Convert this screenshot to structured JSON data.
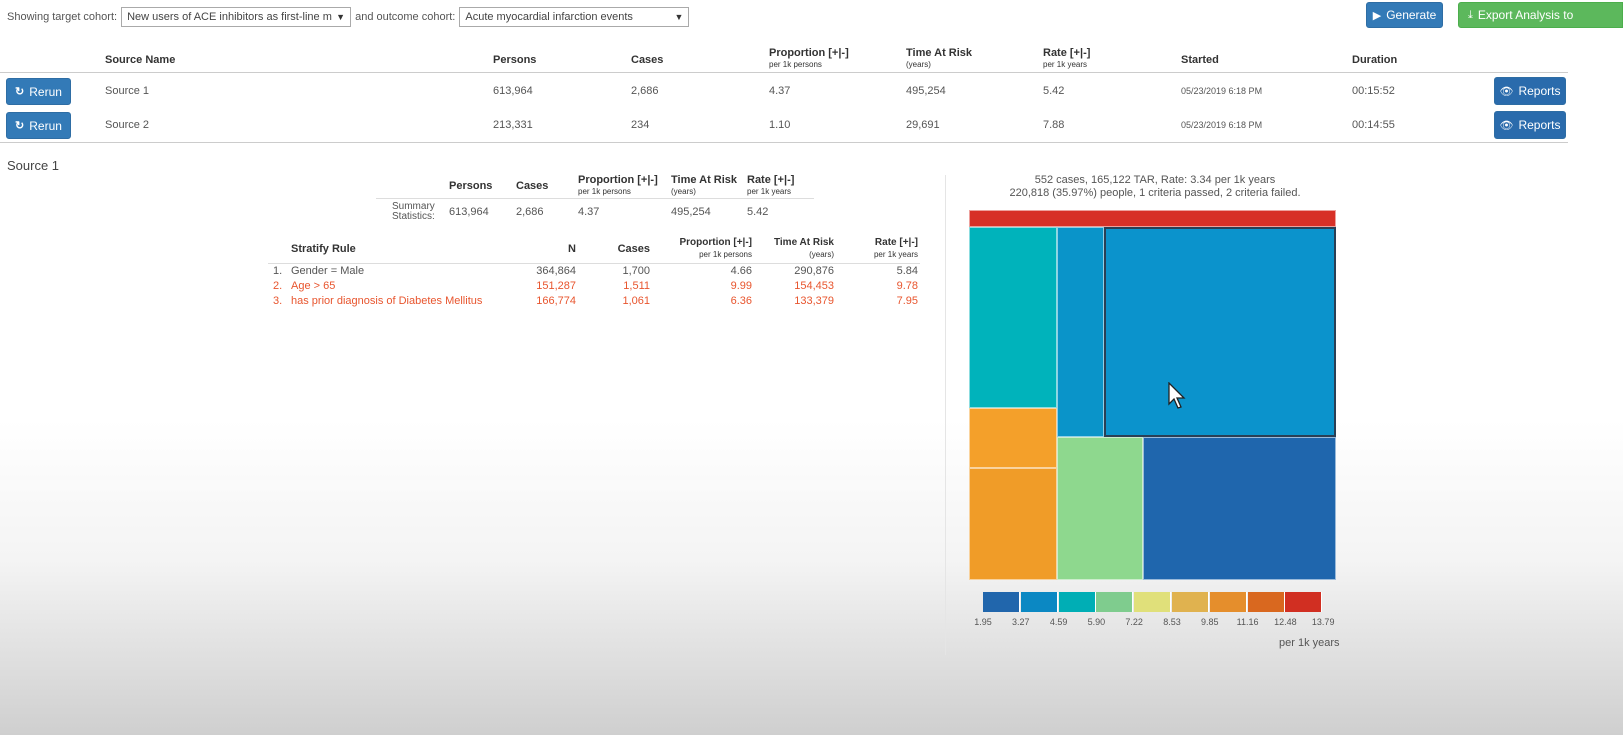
{
  "toolbar": {
    "target_label": "Showing target cohort:",
    "target_value": "New users of ACE inhibitors as first-line mc",
    "outcome_label": "and outcome cohort:",
    "outcome_value": "Acute myocardial infarction events",
    "generate_label": "Generate",
    "export_label": "Export Analysis to"
  },
  "sources_table": {
    "headers": {
      "source_name": "Source Name",
      "persons": "Persons",
      "cases": "Cases",
      "proportion": "Proportion [+|-]",
      "proportion_sub": "per 1k persons",
      "tar": "Time At Risk",
      "tar_sub": "(years)",
      "rate": "Rate [+|-]",
      "rate_sub": "per 1k years",
      "started": "Started",
      "duration": "Duration"
    },
    "rerun_label": "Rerun",
    "reports_label": "Reports",
    "rows": [
      {
        "name": "Source 1",
        "persons": "613,964",
        "cases": "2,686",
        "proportion": "4.37",
        "tar": "495,254",
        "rate": "5.42",
        "started": "05/23/2019 6:18 PM",
        "duration": "00:15:52"
      },
      {
        "name": "Source 2",
        "persons": "213,331",
        "cases": "234",
        "proportion": "1.10",
        "tar": "29,691",
        "rate": "7.88",
        "started": "05/23/2019 6:18 PM",
        "duration": "00:14:55"
      }
    ]
  },
  "detail": {
    "title": "Source 1",
    "summary": {
      "label_line1": "Summary",
      "label_line2": "Statistics:",
      "headers": {
        "persons": "Persons",
        "cases": "Cases",
        "proportion": "Proportion [+|-]",
        "proportion_sub": "per 1k persons",
        "tar": "Time At Risk",
        "tar_sub": "(years)",
        "rate": "Rate [+|-]",
        "rate_sub": "per 1k years"
      },
      "values": {
        "persons": "613,964",
        "cases": "2,686",
        "proportion": "4.37",
        "tar": "495,254",
        "rate": "5.42"
      }
    },
    "stratify": {
      "headers": {
        "rule": "Stratify Rule",
        "n": "N",
        "cases": "Cases",
        "proportion": "Proportion [+|-]",
        "proportion_sub": "per 1k persons",
        "tar": "Time At Risk",
        "tar_sub": "(years)",
        "rate": "Rate [+|-]",
        "rate_sub": "per 1k years"
      },
      "rows": [
        {
          "idx": "1.",
          "rule": "Gender = Male",
          "n": "364,864",
          "cases": "1,700",
          "proportion": "4.66",
          "tar": "290,876",
          "rate": "5.84",
          "status": "passed"
        },
        {
          "idx": "2.",
          "rule": "Age > 65",
          "n": "151,287",
          "cases": "1,511",
          "proportion": "9.99",
          "tar": "154,453",
          "rate": "9.78",
          "status": "failed"
        },
        {
          "idx": "3.",
          "rule": "has prior diagnosis of Diabetes Mellitus",
          "n": "166,774",
          "cases": "1,061",
          "proportion": "6.36",
          "tar": "133,379",
          "rate": "7.95",
          "status": "failed"
        }
      ]
    }
  },
  "treemap": {
    "caption_line1": "552 cases, 165,122 TAR, Rate: 3.34 per 1k years",
    "caption_line2": "220,818 (35.97%) people, 1 criteria passed, 2 criteria failed.",
    "tile_colors": [
      "#d73027",
      "#00b3bb",
      "#0a94c9",
      "#0b93cc",
      "#f4a02a",
      "#f09c28",
      "#8ed88e",
      "#1f66ad"
    ],
    "legend": {
      "colors": [
        "#2166ac",
        "#0b88c3",
        "#00aeb5",
        "#7fcc8e",
        "#e0e07a",
        "#e0b24f",
        "#e58e2c",
        "#d9681f",
        "#d12f22"
      ],
      "ticks": [
        "1.95",
        "3.27",
        "4.59",
        "5.90",
        "7.22",
        "8.53",
        "9.85",
        "11.16",
        "12.48",
        "13.79"
      ],
      "unit": "per 1k years"
    }
  }
}
